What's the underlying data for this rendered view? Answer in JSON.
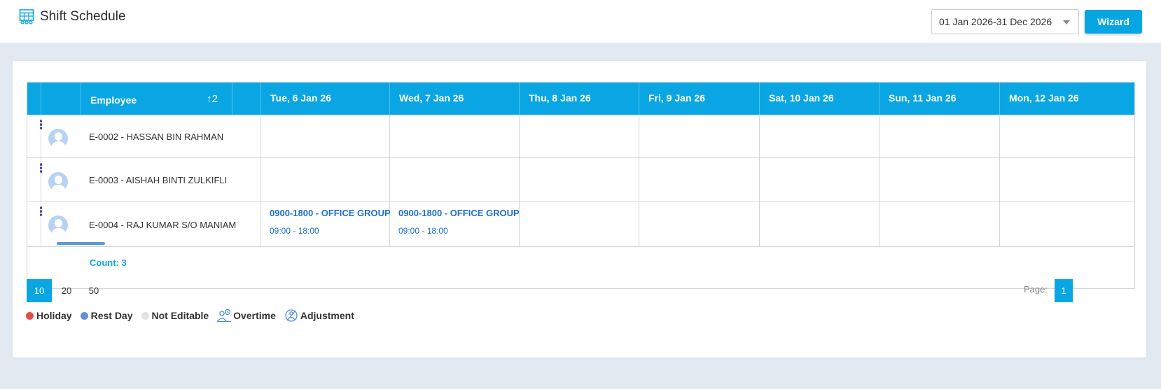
{
  "page": {
    "title": "Shift Schedule"
  },
  "toolbar": {
    "date_range": "01 Jan 2026-31 Dec 2026",
    "wizard_label": "Wizard"
  },
  "grid": {
    "employee_header": "Employee",
    "sort_indicator": "↑2",
    "columns": [
      "Tue, 6 Jan 26",
      "Wed, 7 Jan 26",
      "Thu, 8 Jan 26",
      "Fri, 9 Jan 26",
      "Sat, 10 Jan 26",
      "Sun, 11 Jan 26",
      "Mon, 12 Jan 26"
    ],
    "rows": [
      {
        "employee": "E-0002 - HASSAN BIN RAHMAN",
        "shifts": {}
      },
      {
        "employee": "E-0003 - AISHAH BINTI ZULKIFLI",
        "shifts": {}
      },
      {
        "employee": "E-0004 - RAJ KUMAR S/O MANIAM",
        "shifts": {
          "0": {
            "title": "0900-1800 - OFFICE GROUP",
            "time": "09:00 - 18:00"
          },
          "1": {
            "title": "0900-1800 - OFFICE GROUP",
            "time": "09:00 - 18:00"
          }
        }
      }
    ],
    "count_label": "Count: 3"
  },
  "pagination": {
    "sizes": [
      "10",
      "20",
      "50"
    ],
    "active_size": "10",
    "page_label": "Page:",
    "current_page": "1"
  },
  "legend": [
    {
      "label": "Holiday",
      "type": "dot",
      "color": "#e8494a"
    },
    {
      "label": "Rest Day",
      "type": "dot",
      "color": "#6b8cd9"
    },
    {
      "label": "Not Editable",
      "type": "dot",
      "color": "#e3e3e3"
    },
    {
      "label": "Overtime",
      "type": "icon",
      "icon": "overtime-icon"
    },
    {
      "label": "Adjustment",
      "type": "icon",
      "icon": "adjustment-icon"
    }
  ],
  "colors": {
    "accent": "#0aa6e3",
    "shift_text": "#1d6fd1",
    "menu_dots": "#5a3e96"
  }
}
